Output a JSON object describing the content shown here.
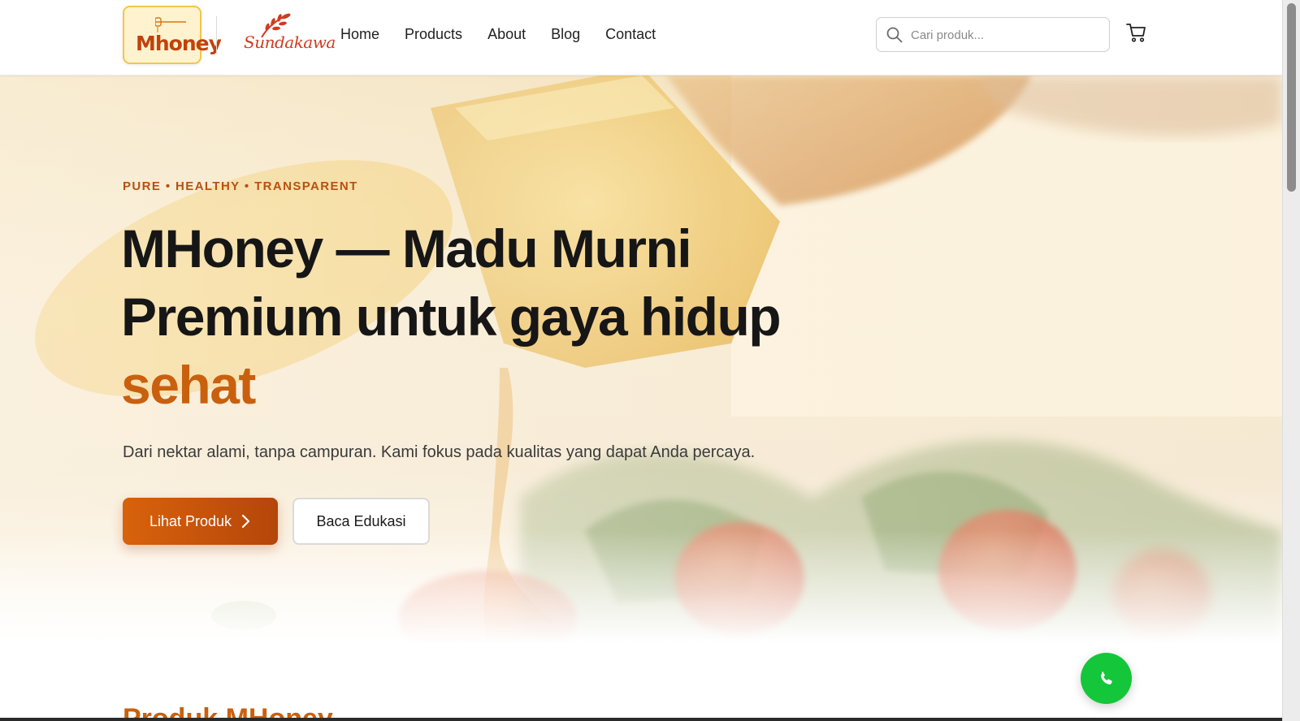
{
  "header": {
    "brand_logo_text": "Mhoney",
    "partner_logo_text": "Sundakawa",
    "nav": [
      {
        "label": "Home"
      },
      {
        "label": "Products"
      },
      {
        "label": "About"
      },
      {
        "label": "Blog"
      },
      {
        "label": "Contact"
      }
    ],
    "search": {
      "placeholder": "Cari produk...",
      "value": ""
    },
    "cart_icon": "cart-icon"
  },
  "hero": {
    "eyebrow": "PURE • HEALTHY • TRANSPARENT",
    "headline_line1": "MHoney — Madu Murni",
    "headline_line2": "Premium untuk gaya hidup",
    "headline_accent": "sehat",
    "subtext": "Dari nektar alami, tanpa campuran. Kami fokus pada kualitas yang dapat Anda percaya.",
    "primary_button": "Lihat Produk",
    "secondary_button": "Baca Edukasi"
  },
  "section": {
    "title": "Produk MHoney"
  },
  "floating": {
    "whatsapp_icon": "whatsapp-phone-icon"
  },
  "colors": {
    "accent": "#c9600e",
    "primary_button": "#d8620c",
    "whatsapp": "#14c63a",
    "logo_border": "#f3c64a"
  }
}
